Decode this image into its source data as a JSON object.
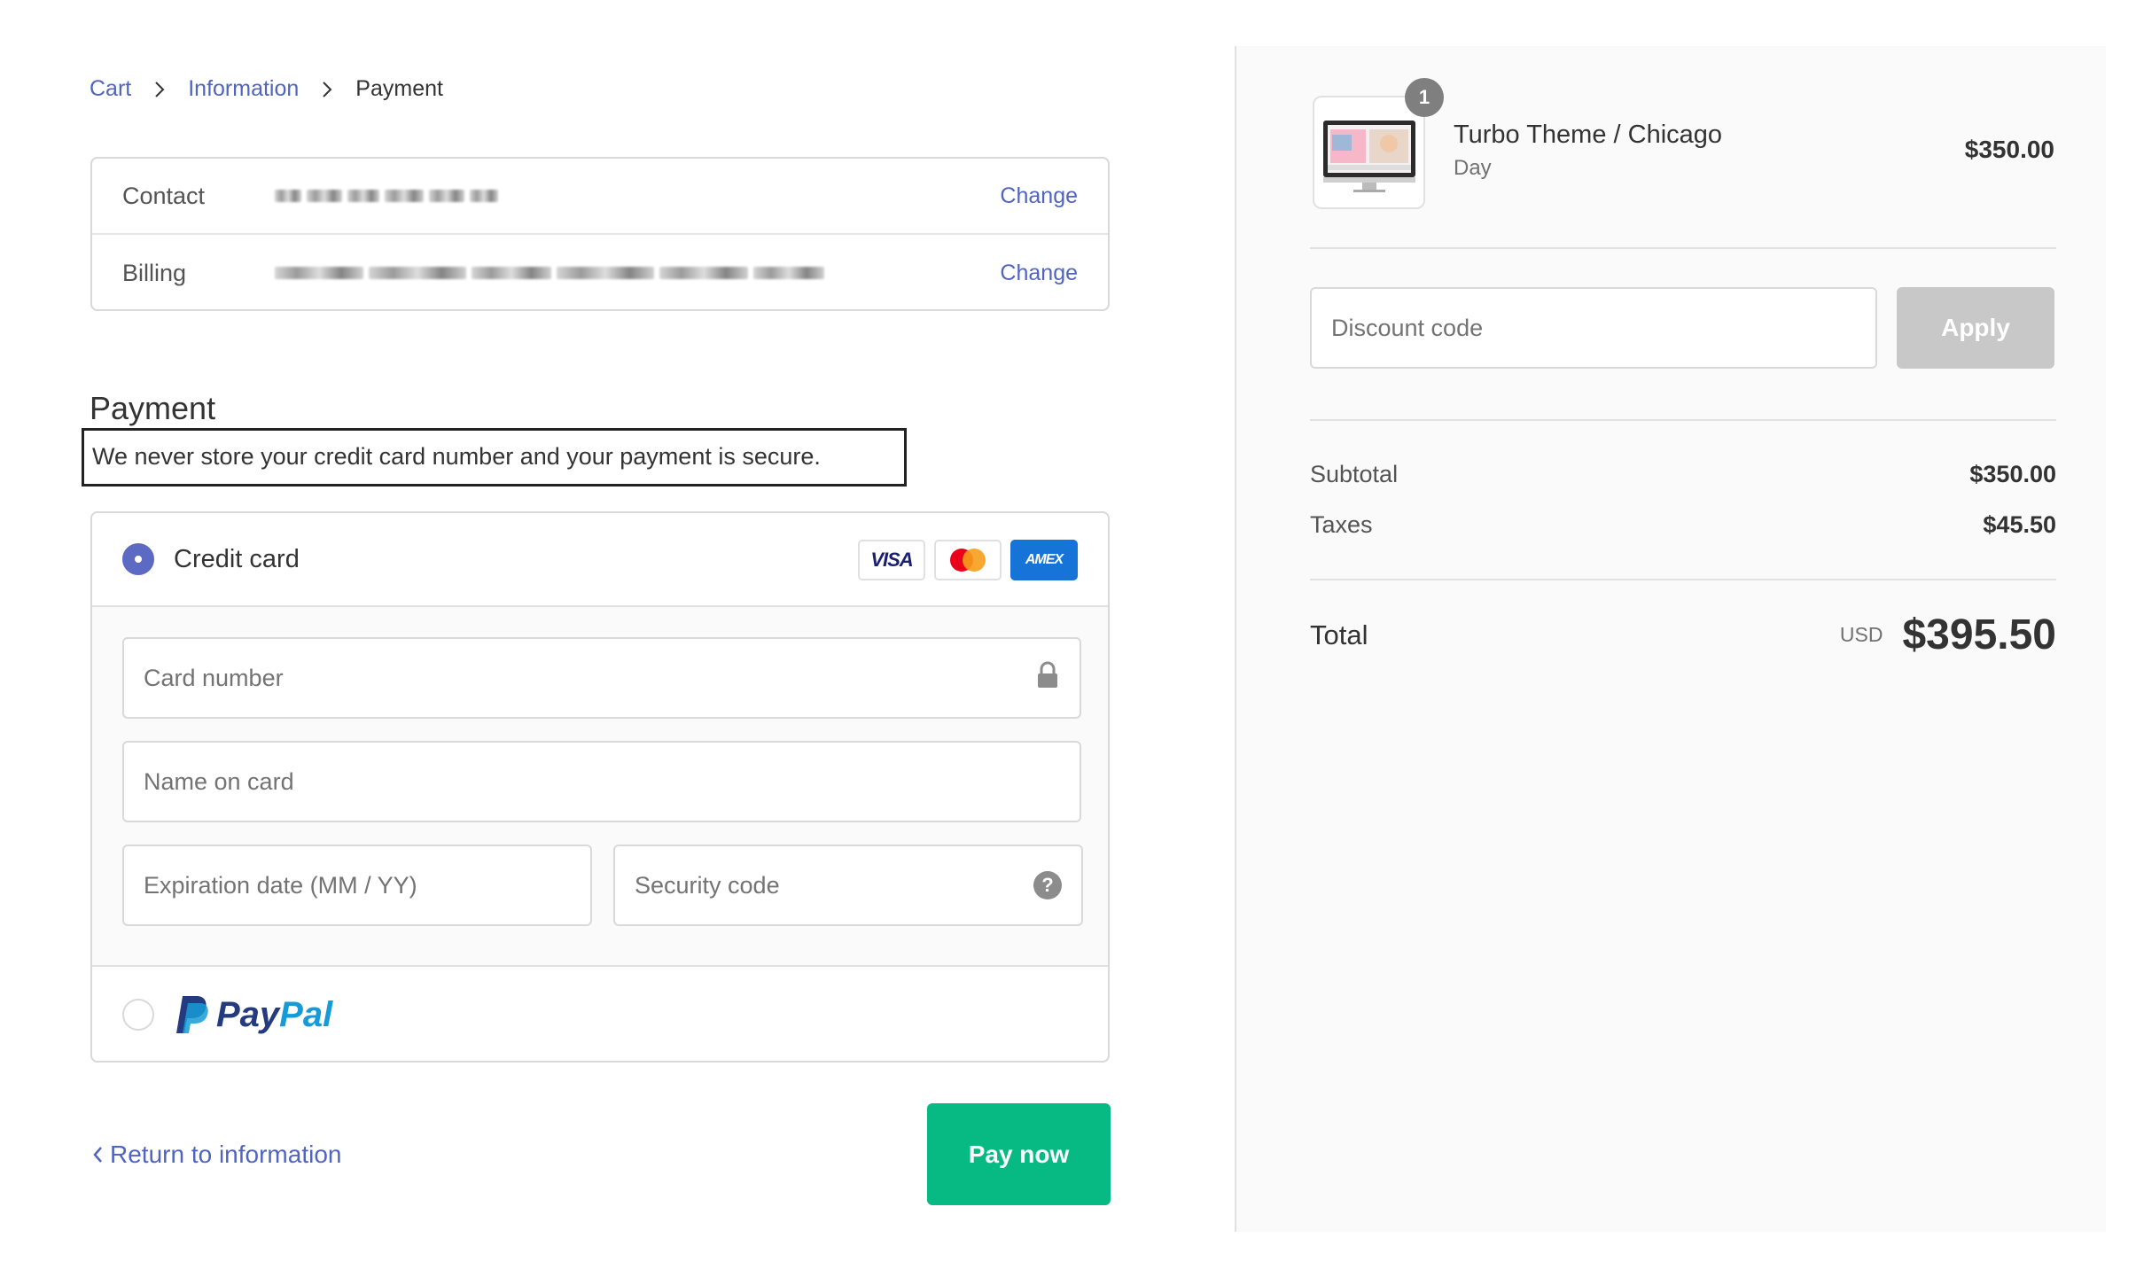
{
  "breadcrumb": {
    "cart": "Cart",
    "information": "Information",
    "payment": "Payment"
  },
  "review": {
    "contact_label": "Contact",
    "billing_label": "Billing",
    "change_label": "Change"
  },
  "payment": {
    "title": "Payment",
    "secure_note": "We never store your credit card number and your payment is secure.",
    "credit_card_label": "Credit card",
    "card_logos": [
      "VISA",
      "AMEX"
    ],
    "fields": {
      "card_number": "Card number",
      "name_on_card": "Name on card",
      "expiration": "Expiration date (MM / YY)",
      "security_code": "Security code"
    },
    "paypal": {
      "part1": "Pay",
      "part2": "Pal"
    }
  },
  "footer": {
    "return_label": "Return to information",
    "pay_label": "Pay now"
  },
  "summary": {
    "product": {
      "name": "Turbo Theme / Chicago",
      "variant": "Day",
      "price": "$350.00",
      "quantity": "1"
    },
    "discount_placeholder": "Discount code",
    "apply_label": "Apply",
    "subtotal_label": "Subtotal",
    "subtotal": "$350.00",
    "taxes_label": "Taxes",
    "taxes": "$45.50",
    "total_label": "Total",
    "currency": "USD",
    "total": "$395.50"
  },
  "colors": {
    "accent": "#5c6ac4",
    "link": "#5064c0",
    "pay_button": "#07b983",
    "apply_button": "#c8c8c8"
  }
}
